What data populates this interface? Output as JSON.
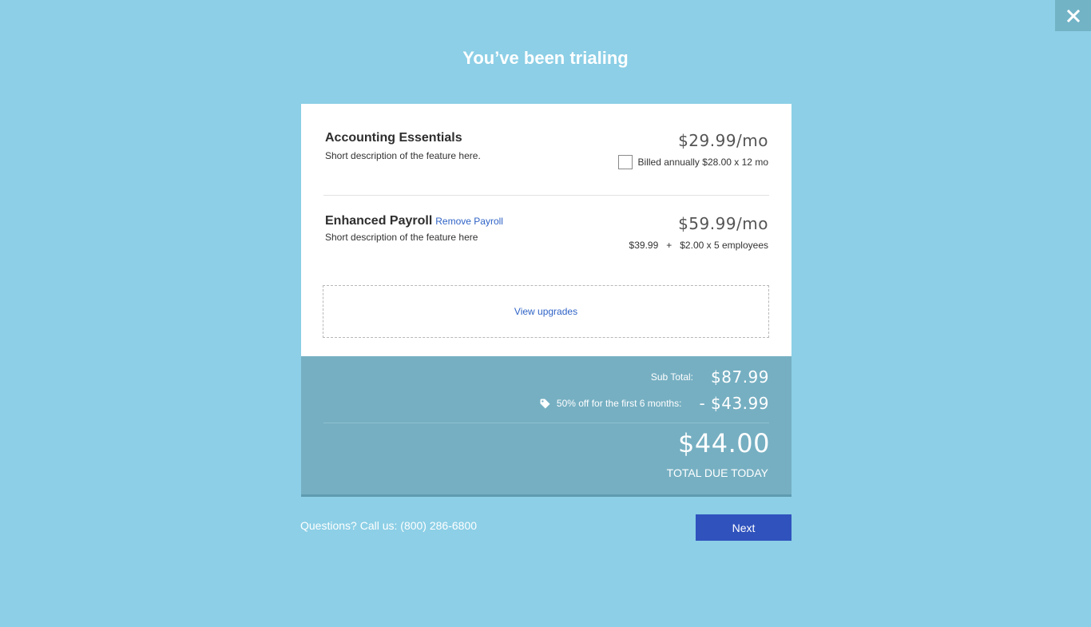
{
  "header": {
    "title": "You’ve been trialing",
    "close_icon": "close-icon"
  },
  "items": [
    {
      "name": "Accounting Essentials",
      "description": "Short description of the feature here.",
      "price": "$29.99/mo",
      "billing_option": {
        "label": "Billed annually $28.00 x 12 mo",
        "checked": false
      }
    },
    {
      "name": "Enhanced Payroll",
      "remove_link": "Remove Payroll",
      "description": "Short description of the feature here",
      "price": "$59.99/mo",
      "price_breakdown": "$39.99   +   $2.00 x 5 employees"
    }
  ],
  "upgrades": {
    "label": "View upgrades"
  },
  "summary": {
    "subtotal_label": "Sub Total:",
    "subtotal_value": "$87.99",
    "discount_label": "50% off for the first 6 months:",
    "discount_value": "- $43.99",
    "discount_icon": "tag-icon",
    "total_value": "$44.00",
    "total_label": "TOTAL DUE TODAY"
  },
  "footer": {
    "questions": "Questions? Call us: (800) 286-6800",
    "next_label": "Next"
  },
  "colors": {
    "background": "#8ccfe6",
    "summary": "#76afc2",
    "accent": "#2f52bd",
    "link": "#2f63c6"
  }
}
